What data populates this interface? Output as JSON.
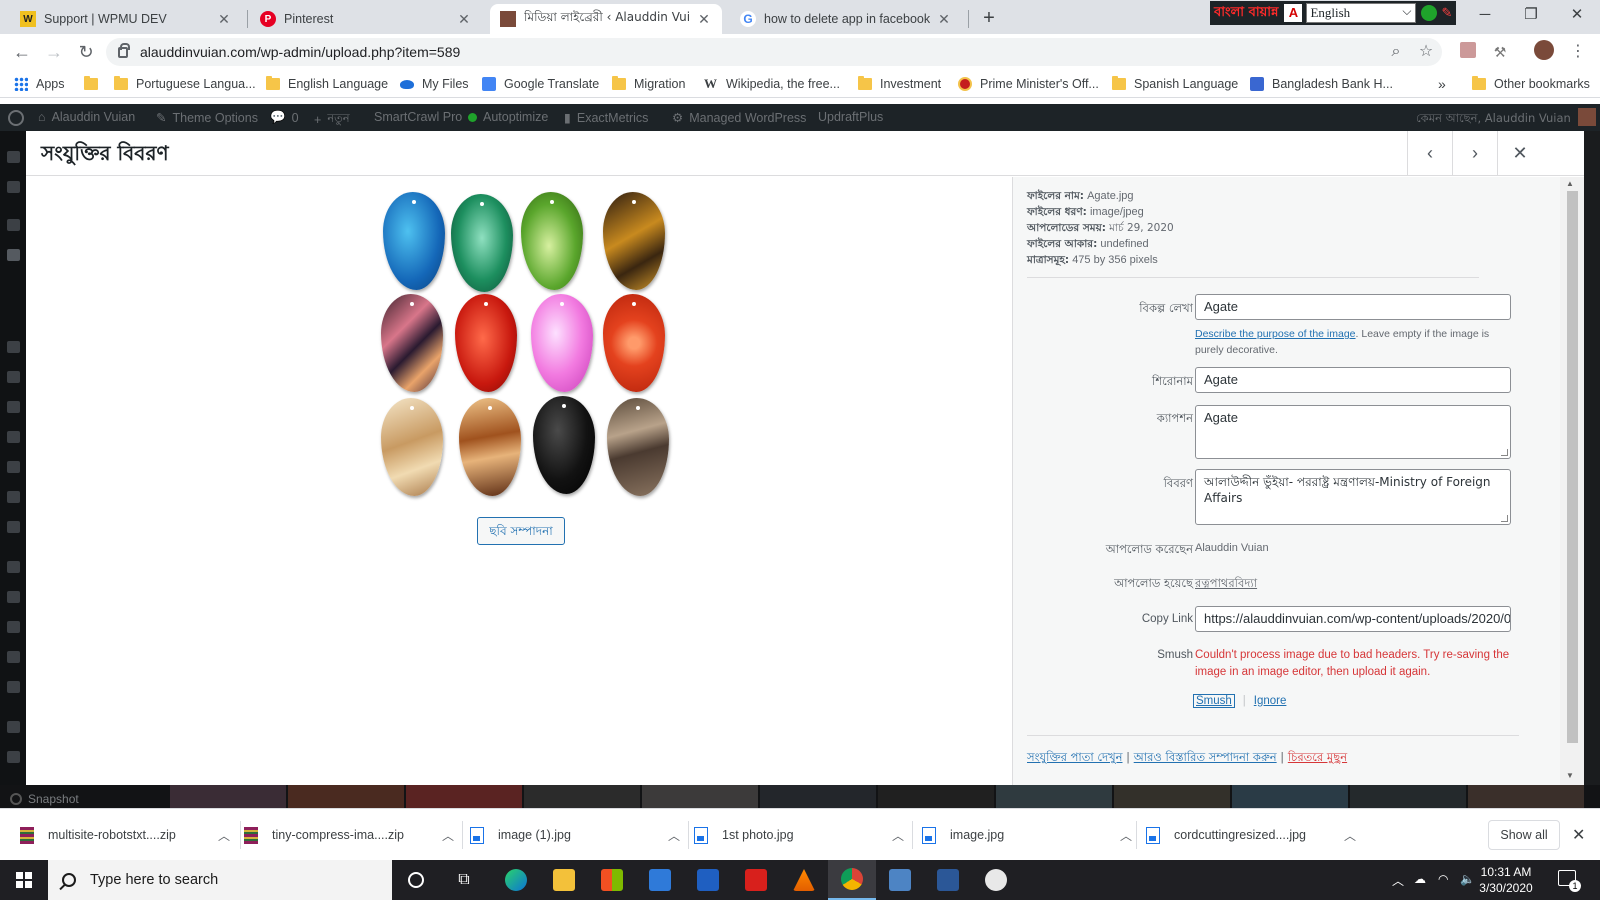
{
  "browser": {
    "tabs": [
      {
        "title": "Support | WPMU DEV",
        "icon": "wpmudev-icon",
        "active": false
      },
      {
        "title": "Pinterest",
        "icon": "pinterest-icon",
        "active": false
      },
      {
        "title": "মিডিয়া লাইব্রেরী ‹ Alauddin Vuian",
        "icon": "site-favicon",
        "active": true
      },
      {
        "title": "how to delete app in facebook -",
        "icon": "google-icon",
        "active": false
      }
    ],
    "url": "alauddinvuian.com/wp-admin/upload.php?item=589",
    "ext_red_text": "বাংলা বায়ান্ন",
    "ext_language": "English"
  },
  "bookmarks": {
    "apps_label": "Apps",
    "items": [
      {
        "label": "",
        "icon": "folder-icon"
      },
      {
        "label": "Portuguese Langua...",
        "icon": "folder-icon"
      },
      {
        "label": "English Language",
        "icon": "folder-icon"
      },
      {
        "label": "My Files",
        "icon": "onedrive-icon"
      },
      {
        "label": "Google Translate",
        "icon": "translate-icon"
      },
      {
        "label": "Migration",
        "icon": "folder-icon"
      },
      {
        "label": "Wikipedia, the free...",
        "icon": "wikipedia-icon"
      },
      {
        "label": "Investment",
        "icon": "folder-icon"
      },
      {
        "label": "Prime Minister's Off...",
        "icon": "bd-seal-icon"
      },
      {
        "label": "Spanish Language",
        "icon": "folder-icon"
      },
      {
        "label": "Bangladesh Bank H...",
        "icon": "bb-icon"
      }
    ],
    "overflow": "»",
    "other": "Other bookmarks"
  },
  "adminbar": {
    "site": "Alauddin Vuian",
    "theme_options": "Theme Options",
    "comments_count": "0",
    "new_label": "নতুন",
    "smartcrawl": "SmartCrawl Pro",
    "autoptimize": "Autoptimize",
    "exactmetrics": "ExactMetrics",
    "managed_wp": "Managed WordPress",
    "updraft": "UpdraftPlus",
    "greeting": "কেমন আছেন, Alauddin Vuian"
  },
  "modal": {
    "title": "সংযুক্তির বিবরণ",
    "edit_image_button": "ছবি সম্পাদনা",
    "file_info": [
      {
        "label": "ফাইলের নাম:",
        "value": "Agate.jpg"
      },
      {
        "label": "ফাইলের ধরণ:",
        "value": "image/jpeg"
      },
      {
        "label": "আপলোডের সময়:",
        "value": "মার্চ 29, 2020"
      },
      {
        "label": "ফাইলের আকার:",
        "value": "undefined"
      },
      {
        "label": "মাত্রাসমূহ:",
        "value": "475 by 356 pixels"
      }
    ],
    "fields": {
      "alt_label": "বিকল্প লেখা",
      "alt_value": "Agate",
      "alt_help_link": "Describe the purpose of the image",
      "alt_help_text": ". Leave empty if the image is purely decorative.",
      "title_label": "শিরোনাম",
      "title_value": "Agate",
      "caption_label": "ক্যাপশন",
      "caption_value": "Agate",
      "description_label": "বিবরণ",
      "description_value": "আলাউদ্দীন ভুঁইয়া- পররাষ্ট্র মন্ত্রণালয়-Ministry of Foreign Affairs",
      "uploaded_by_label": "আপলোড করেছেন",
      "uploaded_by_value": "Alauddin Vuian",
      "uploaded_to_label": "আপলোড হয়েছে",
      "uploaded_to_value": "রত্নপাথরবিদ্যা",
      "copy_link_label": "Copy Link",
      "copy_link_value": "https://alauddinvuian.com/wp-content/uploads/2020/0",
      "smush_label": "Smush",
      "smush_error": "Couldn't process image due to bad headers. Try re-saving the image in an image editor, then upload it again.",
      "smush_link": "Smush",
      "ignore_link": "Ignore"
    },
    "actions": {
      "view": "সংযুক্তির পাতা দেখুন",
      "edit": "আরও বিস্তারিত সম্পাদনা করুন",
      "delete": "চিরতরে মুছুন",
      "separator": "|"
    }
  },
  "underlay": {
    "snapshot": "Snapshot"
  },
  "downloads": {
    "items": [
      {
        "name": "multisite-robotstxt....zip",
        "type": "zip"
      },
      {
        "name": "tiny-compress-ima....zip",
        "type": "zip"
      },
      {
        "name": "image (1).jpg",
        "type": "img"
      },
      {
        "name": "1st photo.jpg",
        "type": "img"
      },
      {
        "name": "image.jpg",
        "type": "img"
      },
      {
        "name": "cordcuttingresized....jpg",
        "type": "img"
      }
    ],
    "show_all": "Show all"
  },
  "taskbar": {
    "search_placeholder": "Type here to search",
    "time": "10:31 AM",
    "date": "3/30/2020"
  }
}
